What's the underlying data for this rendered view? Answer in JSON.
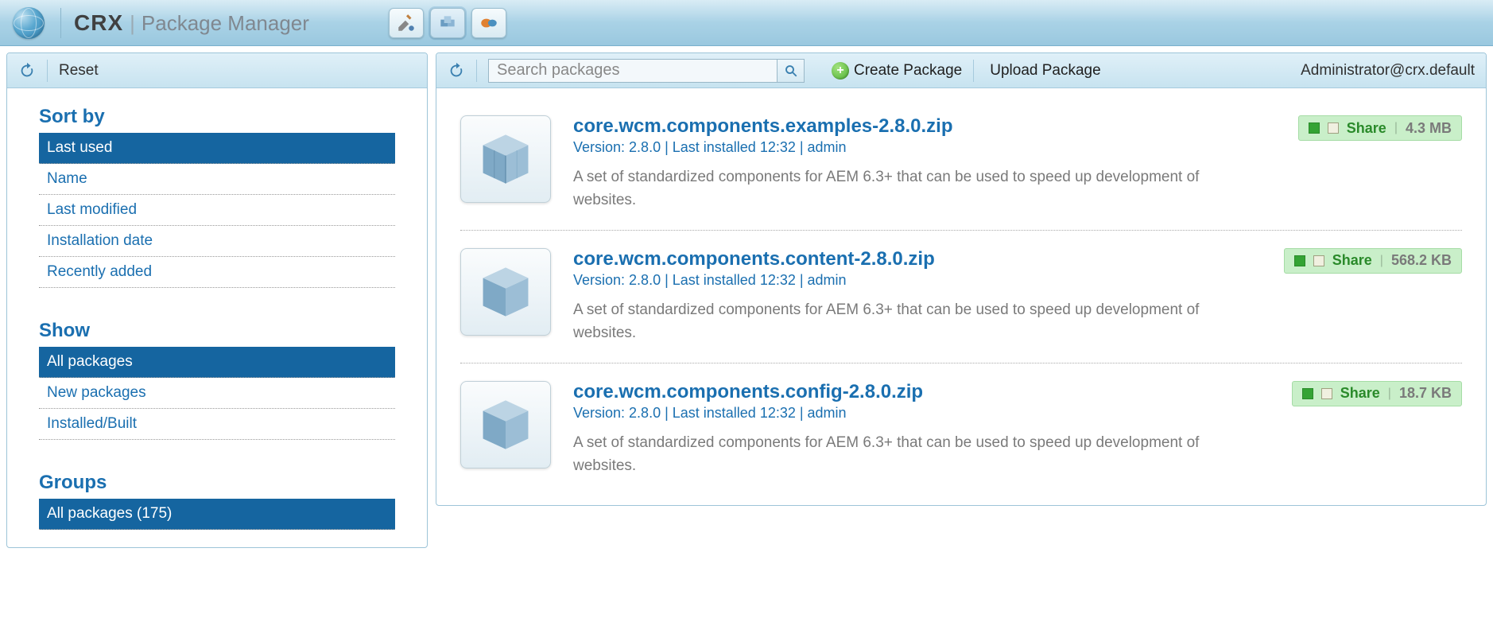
{
  "header": {
    "app_abbrev": "CRX",
    "app_subtitle": "Package Manager"
  },
  "left_toolbar": {
    "reset": "Reset"
  },
  "right_toolbar": {
    "search_placeholder": "Search packages",
    "create": "Create Package",
    "upload": "Upload Package",
    "user": "Administrator@crx.default"
  },
  "sidebar": {
    "sort": {
      "title": "Sort by",
      "items": [
        "Last used",
        "Name",
        "Last modified",
        "Installation date",
        "Recently added"
      ],
      "selected_index": 0
    },
    "show": {
      "title": "Show",
      "items": [
        "All packages",
        "New packages",
        "Installed/Built"
      ],
      "selected_index": 0
    },
    "groups": {
      "title": "Groups",
      "items": [
        "All packages (175)"
      ],
      "selected_index": 0
    }
  },
  "packages": [
    {
      "name": "core.wcm.components.examples-2.8.0.zip",
      "meta": "Version: 2.8.0 | Last installed 12:32 | admin",
      "desc": "A set of standardized components for AEM 6.3+ that can be used to speed up development of websites.",
      "share": "Share",
      "size": "4.3 MB"
    },
    {
      "name": "core.wcm.components.content-2.8.0.zip",
      "meta": "Version: 2.8.0 | Last installed 12:32 | admin",
      "desc": "A set of standardized components for AEM 6.3+ that can be used to speed up development of websites.",
      "share": "Share",
      "size": "568.2 KB"
    },
    {
      "name": "core.wcm.components.config-2.8.0.zip",
      "meta": "Version: 2.8.0 | Last installed 12:32 | admin",
      "desc": "A set of standardized components for AEM 6.3+ that can be used to speed up development of websites.",
      "share": "Share",
      "size": "18.7 KB"
    }
  ]
}
